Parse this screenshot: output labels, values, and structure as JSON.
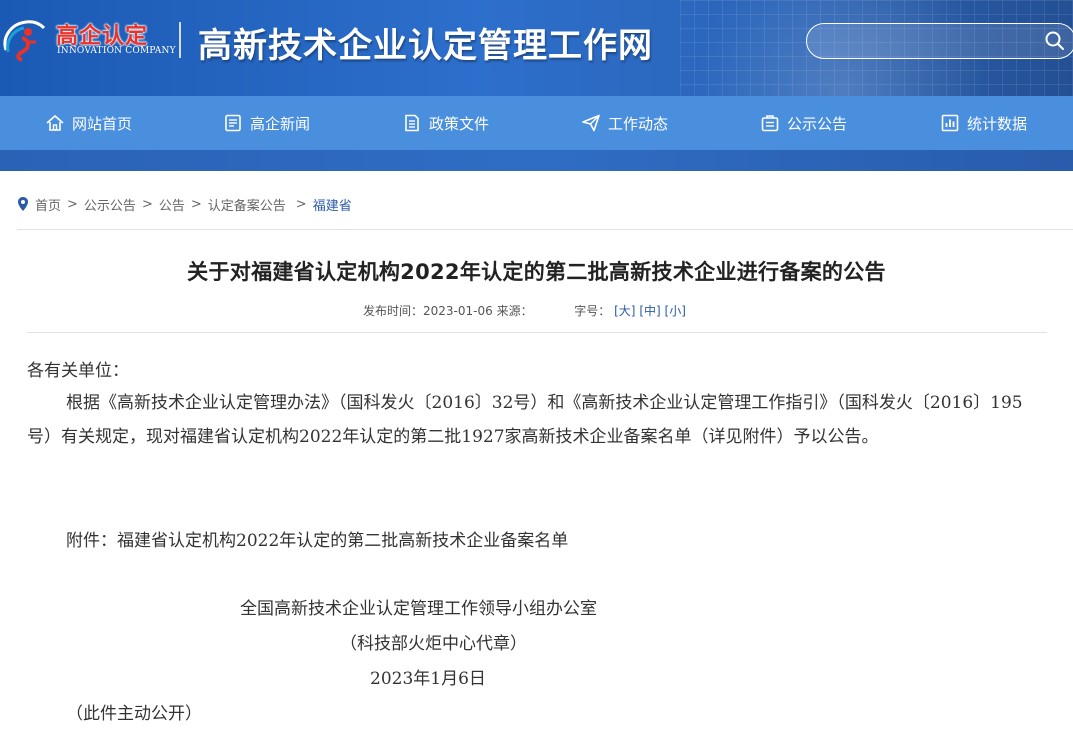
{
  "header": {
    "logo_cn": "高企认定",
    "logo_en": "INNOVATION COMPANY",
    "site_title": "高新技术企业认定管理工作网",
    "search_placeholder": ""
  },
  "nav": {
    "items": [
      {
        "label": "网站首页",
        "icon": "home-icon"
      },
      {
        "label": "高企新闻",
        "icon": "news-icon"
      },
      {
        "label": "政策文件",
        "icon": "document-icon"
      },
      {
        "label": "工作动态",
        "icon": "send-icon"
      },
      {
        "label": "公示公告",
        "icon": "announcement-icon"
      },
      {
        "label": "统计数据",
        "icon": "chart-icon"
      }
    ]
  },
  "breadcrumb": {
    "items": [
      "首页",
      "公示公告",
      "公告",
      "认定备案公告"
    ],
    "current": "福建省"
  },
  "article": {
    "title": "关于对福建省认定机构2022年认定的第二批高新技术企业进行备案的公告",
    "publish_label": "发布时间：",
    "publish_date": "2023-01-06",
    "source_label": "来源：",
    "fontsize_label": "字号：",
    "font_sizes": [
      "[大]",
      "[中]",
      "[小]"
    ],
    "salutation": "各有关单位：",
    "paragraph": "根据《高新技术企业认定管理办法》（国科发火〔2016〕32号）和《高新技术企业认定管理工作指引》（国科发火〔2016〕195号）有关规定，现对福建省认定机构2022年认定的第二批1927家高新技术企业备案名单（详见附件）予以公告。",
    "attachment": "附件：福建省认定机构2022年认定的第二批高新技术企业备案名单",
    "signature_org": "全国高新技术企业认定管理工作领导小组办公室",
    "signature_sub": "（科技部火炬中心代章）",
    "signature_date": "2023年1月6日",
    "note": "（此件主动公开）"
  },
  "colors": {
    "header_bg": "#1b5ab4",
    "nav_bg": "#4a8fde",
    "logo_red": "#e8322c",
    "link_blue": "#2b5ba8"
  }
}
